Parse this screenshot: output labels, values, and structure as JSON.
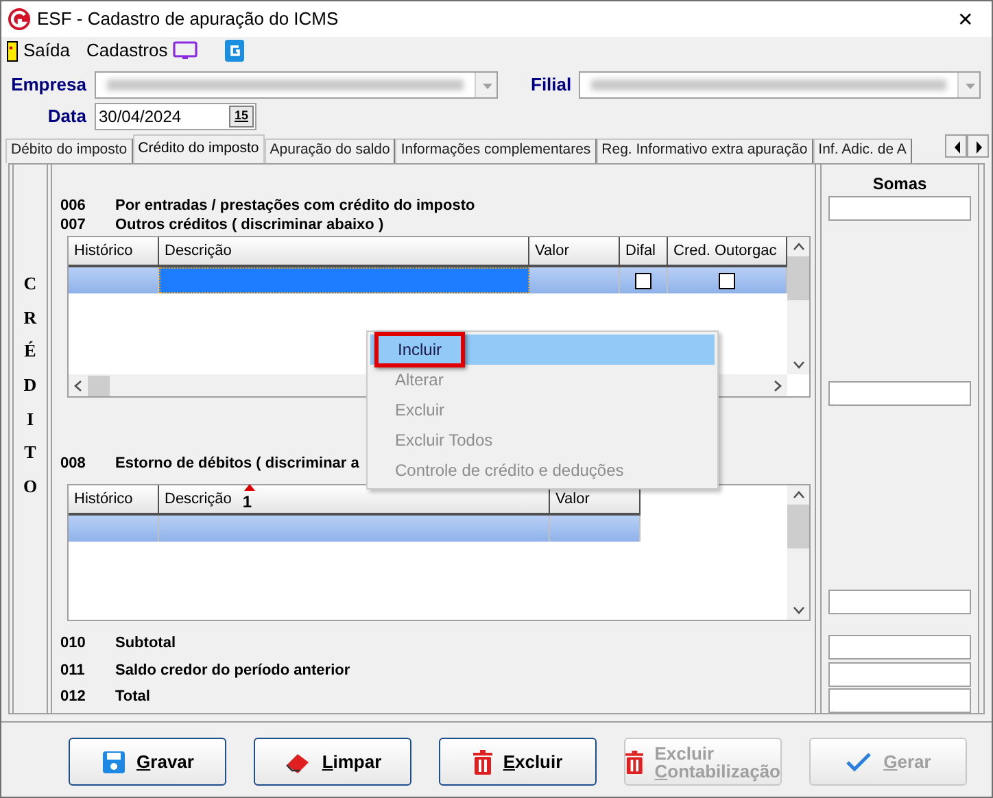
{
  "window": {
    "title": "ESF - Cadastro de apuração do ICMS",
    "close": "✕"
  },
  "menu": [
    {
      "label": "Saída"
    },
    {
      "label": "Cadastros"
    }
  ],
  "form": {
    "empresa_label": "Empresa",
    "filial_label": "Filial",
    "data_label": "Data",
    "data_value": "30/04/2024",
    "calendar_glyph": "15"
  },
  "tabs": [
    {
      "label": "Débito do imposto",
      "selected": false
    },
    {
      "label": "Crédito do imposto",
      "selected": true
    },
    {
      "label": "Apuração do saldo",
      "selected": false
    },
    {
      "label": "Informações complementares",
      "selected": false
    },
    {
      "label": "Reg. Informativo extra apuração",
      "selected": false
    },
    {
      "label": "Inf. Adic. de A",
      "selected": false
    }
  ],
  "side_label": "CRÉDITO",
  "lines_top": [
    {
      "code": "006",
      "text": "Por entradas / prestações com crédito do imposto"
    },
    {
      "code": "007",
      "text": "Outros créditos ( discriminar abaixo )"
    }
  ],
  "grid1": {
    "columns": [
      "Histórico",
      "Descrição",
      "Valor",
      "Difal",
      "Cred. Outorgac"
    ],
    "rows": [
      {
        "selected": true,
        "difal": false,
        "cred_outorgado": false
      }
    ]
  },
  "line_mid": {
    "code": "008",
    "text": "Estorno de débitos ( discriminar a"
  },
  "grid2": {
    "columns": [
      "Histórico",
      "Descrição",
      "Valor"
    ],
    "sort_mark": "1",
    "rows": [
      {
        "selected": true
      }
    ]
  },
  "lines_bottom": [
    {
      "code": "010",
      "text": "Subtotal"
    },
    {
      "code": "011",
      "text": "Saldo credor do período anterior"
    },
    {
      "code": "012",
      "text": "Total"
    }
  ],
  "somas_label": "Somas",
  "context_menu": [
    {
      "label": "Incluir",
      "selected": true,
      "disabled": false
    },
    {
      "label": "Alterar",
      "selected": false,
      "disabled": true
    },
    {
      "label": "Excluir",
      "selected": false,
      "disabled": true
    },
    {
      "label": "Excluir Todos",
      "selected": false,
      "disabled": true
    },
    {
      "label": "Controle de crédito e deduções",
      "selected": false,
      "disabled": true
    }
  ],
  "buttons": [
    {
      "lines": [
        "Gravar"
      ],
      "kind": "save",
      "disabled": false
    },
    {
      "lines": [
        "Limpar"
      ],
      "kind": "eraser",
      "disabled": false
    },
    {
      "lines": [
        "Excluir"
      ],
      "kind": "trash",
      "disabled": false
    },
    {
      "lines": [
        "Excluir",
        "Contabilização"
      ],
      "kind": "trash",
      "disabled": true
    },
    {
      "lines": [
        "Gerar"
      ],
      "kind": "check",
      "disabled": true
    }
  ]
}
